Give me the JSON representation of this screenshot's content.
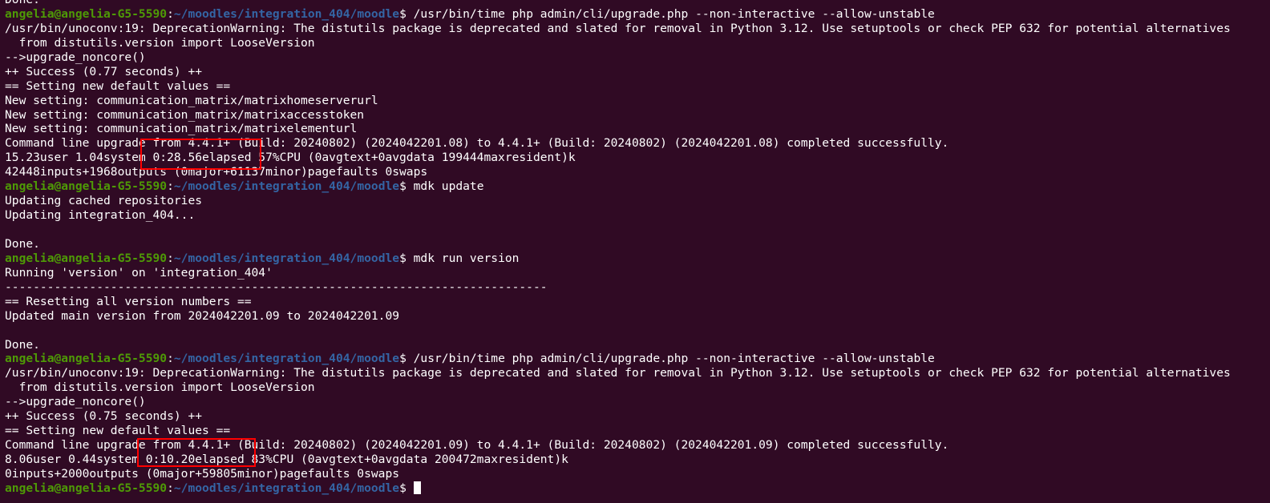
{
  "terminal": {
    "colors": {
      "background": "#300a24",
      "foreground": "#ffffff",
      "prompt_user": "#4e9a06",
      "prompt_path": "#3465a4",
      "highlight": "#ff0000"
    },
    "lines": [
      {
        "type": "output",
        "text": "Done."
      },
      {
        "type": "prompt",
        "user": "angelia@angelia-G5-5590",
        "sep": ":",
        "path": "~/moodles/integration_404/moodle",
        "cmd": "$ /usr/bin/time php admin/cli/upgrade.php --non-interactive --allow-unstable"
      },
      {
        "type": "output",
        "text": "/usr/bin/unoconv:19: DeprecationWarning: The distutils package is deprecated and slated for removal in Python 3.12. Use setuptools or check PEP 632 for potential alternatives"
      },
      {
        "type": "output",
        "text": "  from distutils.version import LooseVersion"
      },
      {
        "type": "output",
        "text": "-->upgrade_noncore()"
      },
      {
        "type": "output",
        "text": "++ Success (0.77 seconds) ++"
      },
      {
        "type": "output",
        "text": "== Setting new default values =="
      },
      {
        "type": "output",
        "text": "New setting: communication_matrix/matrixhomeserverurl"
      },
      {
        "type": "output",
        "text": "New setting: communication_matrix/matrixaccesstoken"
      },
      {
        "type": "output",
        "text": "New setting: communication_matrix/matrixelementurl"
      },
      {
        "type": "output",
        "text": "Command line upgrade from 4.4.1+ (Build: 20240802) (2024042201.08) to 4.4.1+ (Build: 20240802) (2024042201.08) completed successfully."
      },
      {
        "type": "output",
        "text": "15.23user 1.04system 0:28.56elapsed 57%CPU (0avgtext+0avgdata 199444maxresident)k"
      },
      {
        "type": "output",
        "text": "42448inputs+1968outputs (0major+61137minor)pagefaults 0swaps"
      },
      {
        "type": "prompt",
        "user": "angelia@angelia-G5-5590",
        "sep": ":",
        "path": "~/moodles/integration_404/moodle",
        "cmd": "$ mdk update"
      },
      {
        "type": "output",
        "text": "Updating cached repositories"
      },
      {
        "type": "output",
        "text": "Updating integration_404..."
      },
      {
        "type": "output",
        "text": ""
      },
      {
        "type": "output",
        "text": "Done."
      },
      {
        "type": "prompt",
        "user": "angelia@angelia-G5-5590",
        "sep": ":",
        "path": "~/moodles/integration_404/moodle",
        "cmd": "$ mdk run version"
      },
      {
        "type": "output",
        "text": "Running 'version' on 'integration_404'"
      },
      {
        "type": "output",
        "text": "-----------------------------------------------------------------------------"
      },
      {
        "type": "output",
        "text": "== Resetting all version numbers =="
      },
      {
        "type": "output",
        "text": "Updated main version from 2024042201.09 to 2024042201.09"
      },
      {
        "type": "output",
        "text": ""
      },
      {
        "type": "output",
        "text": "Done."
      },
      {
        "type": "prompt",
        "user": "angelia@angelia-G5-5590",
        "sep": ":",
        "path": "~/moodles/integration_404/moodle",
        "cmd": "$ /usr/bin/time php admin/cli/upgrade.php --non-interactive --allow-unstable"
      },
      {
        "type": "output",
        "text": "/usr/bin/unoconv:19: DeprecationWarning: The distutils package is deprecated and slated for removal in Python 3.12. Use setuptools or check PEP 632 for potential alternatives"
      },
      {
        "type": "output",
        "text": "  from distutils.version import LooseVersion"
      },
      {
        "type": "output",
        "text": "-->upgrade_noncore()"
      },
      {
        "type": "output",
        "text": "++ Success (0.75 seconds) ++"
      },
      {
        "type": "output",
        "text": "== Setting new default values =="
      },
      {
        "type": "output",
        "text": "Command line upgrade from 4.4.1+ (Build: 20240802) (2024042201.09) to 4.4.1+ (Build: 20240802) (2024042201.09) completed successfully."
      },
      {
        "type": "output",
        "text": "8.06user 0.44system 0:10.20elapsed 83%CPU (0avgtext+0avgdata 200472maxresident)k"
      },
      {
        "type": "output",
        "text": "0inputs+2000outputs (0major+59805minor)pagefaults 0swaps"
      },
      {
        "type": "prompt",
        "user": "angelia@angelia-G5-5590",
        "sep": ":",
        "path": "~/moodles/integration_404/moodle",
        "cmd": "$ ",
        "cursor": true
      }
    ]
  }
}
